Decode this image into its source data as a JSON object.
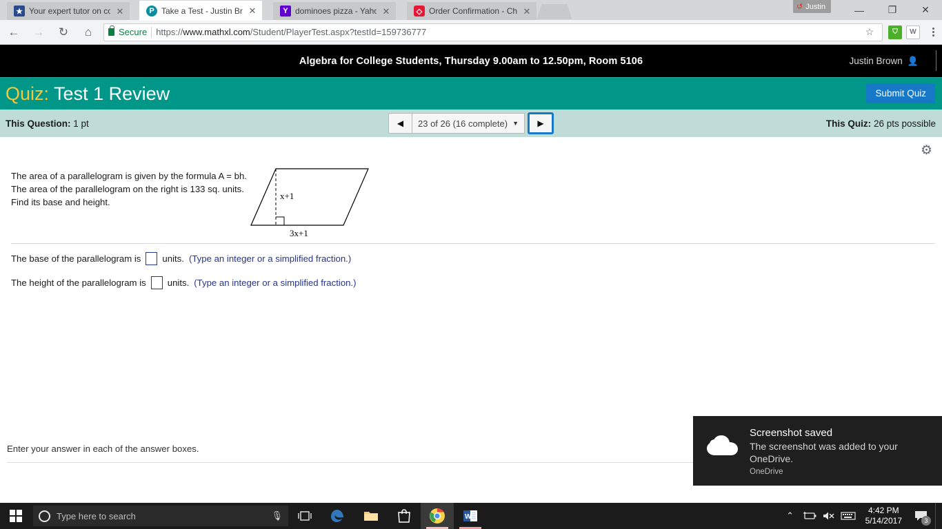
{
  "browser": {
    "tabs": [
      {
        "title": "Your expert tutor on cou",
        "favicon": "shield-star-icon",
        "active": false
      },
      {
        "title": "Take a Test - Justin Brown",
        "favicon": "pearson-p-icon",
        "active": true
      },
      {
        "title": "dominoes pizza - Yahoo S",
        "favicon": "yahoo-y-icon",
        "active": false
      },
      {
        "title": "Order Confirmation - Che",
        "favicon": "dominos-icon",
        "active": false
      }
    ],
    "close_glyph": "✕",
    "profile_label": "Justin",
    "sync_glyph": "↺",
    "window_controls": {
      "minimize": "—",
      "maximize": "❐",
      "close": "✕"
    },
    "back_glyph": "←",
    "forward_glyph": "→",
    "reload_glyph": "↻",
    "home_glyph": "⌂",
    "security_label": "Secure",
    "url_scheme": "https://",
    "url_host": "www.mathxl.com",
    "url_path": "/Student/PlayerTest.aspx?testId=159736777",
    "star_glyph": "☆",
    "extensions": [
      {
        "name": "green-shield-extension-icon",
        "glyph": "⛉"
      },
      {
        "name": "w-bubble-extension-icon",
        "glyph": "W"
      }
    ]
  },
  "mathxl": {
    "course_header": "Algebra for College Students, Thursday 9.00am to 12.50pm, Room 5106",
    "user_name": "Justin Brown",
    "quiz_label": "Quiz:",
    "quiz_title": "Test 1 Review",
    "submit_label": "Submit Quiz",
    "question_points_label": "This Question:",
    "question_points_value": "1 pt",
    "quiz_points_label": "This Quiz:",
    "quiz_points_value": "26 pts possible",
    "nav": {
      "prev_glyph": "◀",
      "next_glyph": "▶",
      "selector_text": "23 of 26 (16 complete)",
      "caret_glyph": "▼",
      "current_question": 23,
      "total_questions": 26,
      "completed": 16
    },
    "gear_glyph": "⚙",
    "question": {
      "stem_line1": "The area of a parallelogram is given by the formula A = bh.",
      "stem_line2": "The area of the parallelogram on the right is 133 sq. units.",
      "stem_line3": "Find its base and height.",
      "figure": {
        "name": "parallelogram-diagram",
        "height_label": "x+1",
        "base_label": "3x+1"
      },
      "answers": [
        {
          "prompt": "The base of the parallelogram is",
          "value": "",
          "unit": "units.",
          "hint": "(Type an integer or a simplified fraction.)"
        },
        {
          "prompt": "The height of the parallelogram is",
          "value": "",
          "unit": "units.",
          "hint": "(Type an integer or a simplified fraction.)"
        }
      ]
    },
    "footer_text": "Enter your answer in each of the answer boxes.",
    "page_arrows": {
      "prev_glyph": "◀",
      "next_glyph": "▶"
    }
  },
  "toast": {
    "icon": "onedrive-cloud-icon",
    "title": "Screenshot saved",
    "body": "The screenshot was added to your OneDrive.",
    "app": "OneDrive"
  },
  "taskbar": {
    "search_placeholder": "Type here to search",
    "mic_glyph": "Ἲ4",
    "buttons": [
      {
        "name": "task-view-button",
        "glyph": "⌷"
      },
      {
        "name": "edge-button",
        "glyph": "e"
      },
      {
        "name": "file-explorer-button",
        "glyph": "Ὄ1"
      },
      {
        "name": "microsoft-store-button",
        "glyph": "ὬD"
      },
      {
        "name": "chrome-button",
        "glyph": "●"
      },
      {
        "name": "word-button",
        "glyph": "W"
      }
    ],
    "tray": {
      "chevron_glyph": "⌃",
      "battery_glyph": "ὐC",
      "volume_glyph": "ὐ7",
      "keyboard_glyph": "⌨",
      "time": "4:42 PM",
      "date": "5/14/2017",
      "notification_count": "3"
    }
  },
  "colors": {
    "teal_bar": "#009688",
    "submit_blue": "#1878c8",
    "info_bar": "#bfdcd9",
    "quiz_label_gold": "#f5c73c",
    "hint_navy": "#26348a",
    "secure_green": "#0b8043"
  }
}
